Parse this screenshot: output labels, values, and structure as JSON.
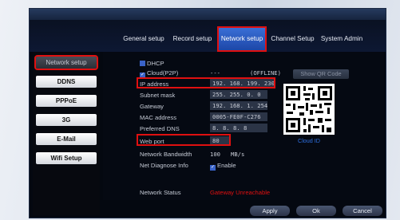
{
  "tabs": [
    {
      "label": "General setup"
    },
    {
      "label": "Record setup"
    },
    {
      "label": "Network setup"
    },
    {
      "label": "Channel Setup"
    },
    {
      "label": "System Admin"
    }
  ],
  "sidebar": {
    "items": [
      {
        "label": "Network setup"
      },
      {
        "label": "DDNS"
      },
      {
        "label": "PPPoE"
      },
      {
        "label": "3G"
      },
      {
        "label": "E-Mail"
      },
      {
        "label": "Wifi Setup"
      }
    ]
  },
  "form": {
    "dhcp_label": "DHCP",
    "cloud_label": "Cloud(P2P)",
    "cloud_dash": "---",
    "cloud_status": "(OFFLINE)",
    "show_qr_label": "Show QR Code",
    "ip_label": "IP address",
    "ip_value": "192. 168. 199. 230",
    "subnet_label": "Subnet mask",
    "subnet_value": "255. 255.  0.  0",
    "gateway_label": "Gateway",
    "gateway_value": "192. 168.  1. 254",
    "mac_label": "MAC address",
    "mac_value": "0005-FE0F-C276",
    "dns_label": "Preferred DNS",
    "dns_value": "8.   8.   8.   8",
    "port_label": "Web port",
    "port_value": "80",
    "bandwidth_label": "Network Bandwidth",
    "bandwidth_value": "100",
    "bandwidth_unit": "MB/s",
    "diag_label": "Net Diagnose Info",
    "diag_value": "Enable",
    "status_label": "Network Status",
    "status_value": "Gateway Unreachable"
  },
  "qr": {
    "caption": "Cloud ID"
  },
  "buttons": {
    "apply": "Apply",
    "ok": "Ok",
    "cancel": "Cancel"
  },
  "colors": {
    "accent": "#1d47a8",
    "highlight": "#e01010",
    "status_error": "#e01010",
    "link": "#2e6fe0"
  }
}
